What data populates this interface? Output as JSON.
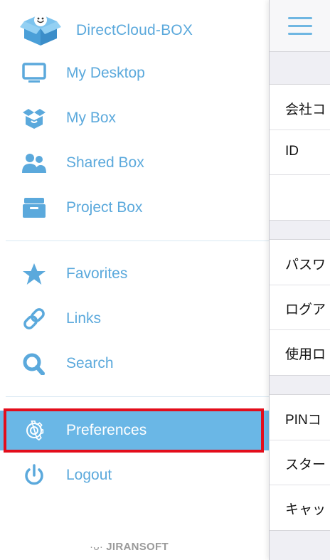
{
  "brand": {
    "name": "DirectCloud-BOX",
    "footer": "JIRANSOFT",
    "footer_mark": "·ᴗ·"
  },
  "colors": {
    "accent": "#5ba9dc",
    "active_bg": "#6ab7e6",
    "highlight": "#e30d1b"
  },
  "sidebar": {
    "items": [
      {
        "label": "My Desktop",
        "icon": "monitor-icon"
      },
      {
        "label": "My Box",
        "icon": "box-icon"
      },
      {
        "label": "Shared Box",
        "icon": "users-icon"
      },
      {
        "label": "Project Box",
        "icon": "archive-icon"
      },
      {
        "label": "Favorites",
        "icon": "star-icon"
      },
      {
        "label": "Links",
        "icon": "link-icon"
      },
      {
        "label": "Search",
        "icon": "search-icon"
      },
      {
        "label": "Preferences",
        "icon": "gear-icon",
        "active": true
      },
      {
        "label": "Logout",
        "icon": "power-icon"
      }
    ]
  },
  "panel": {
    "menu_icon": "hamburger-icon",
    "section1": [
      "会社コ",
      "ID",
      ""
    ],
    "section2": [
      "パスワ",
      "ログア",
      "使用ロ"
    ],
    "section3": [
      "PINコ",
      "スター",
      "キャッ"
    ]
  }
}
